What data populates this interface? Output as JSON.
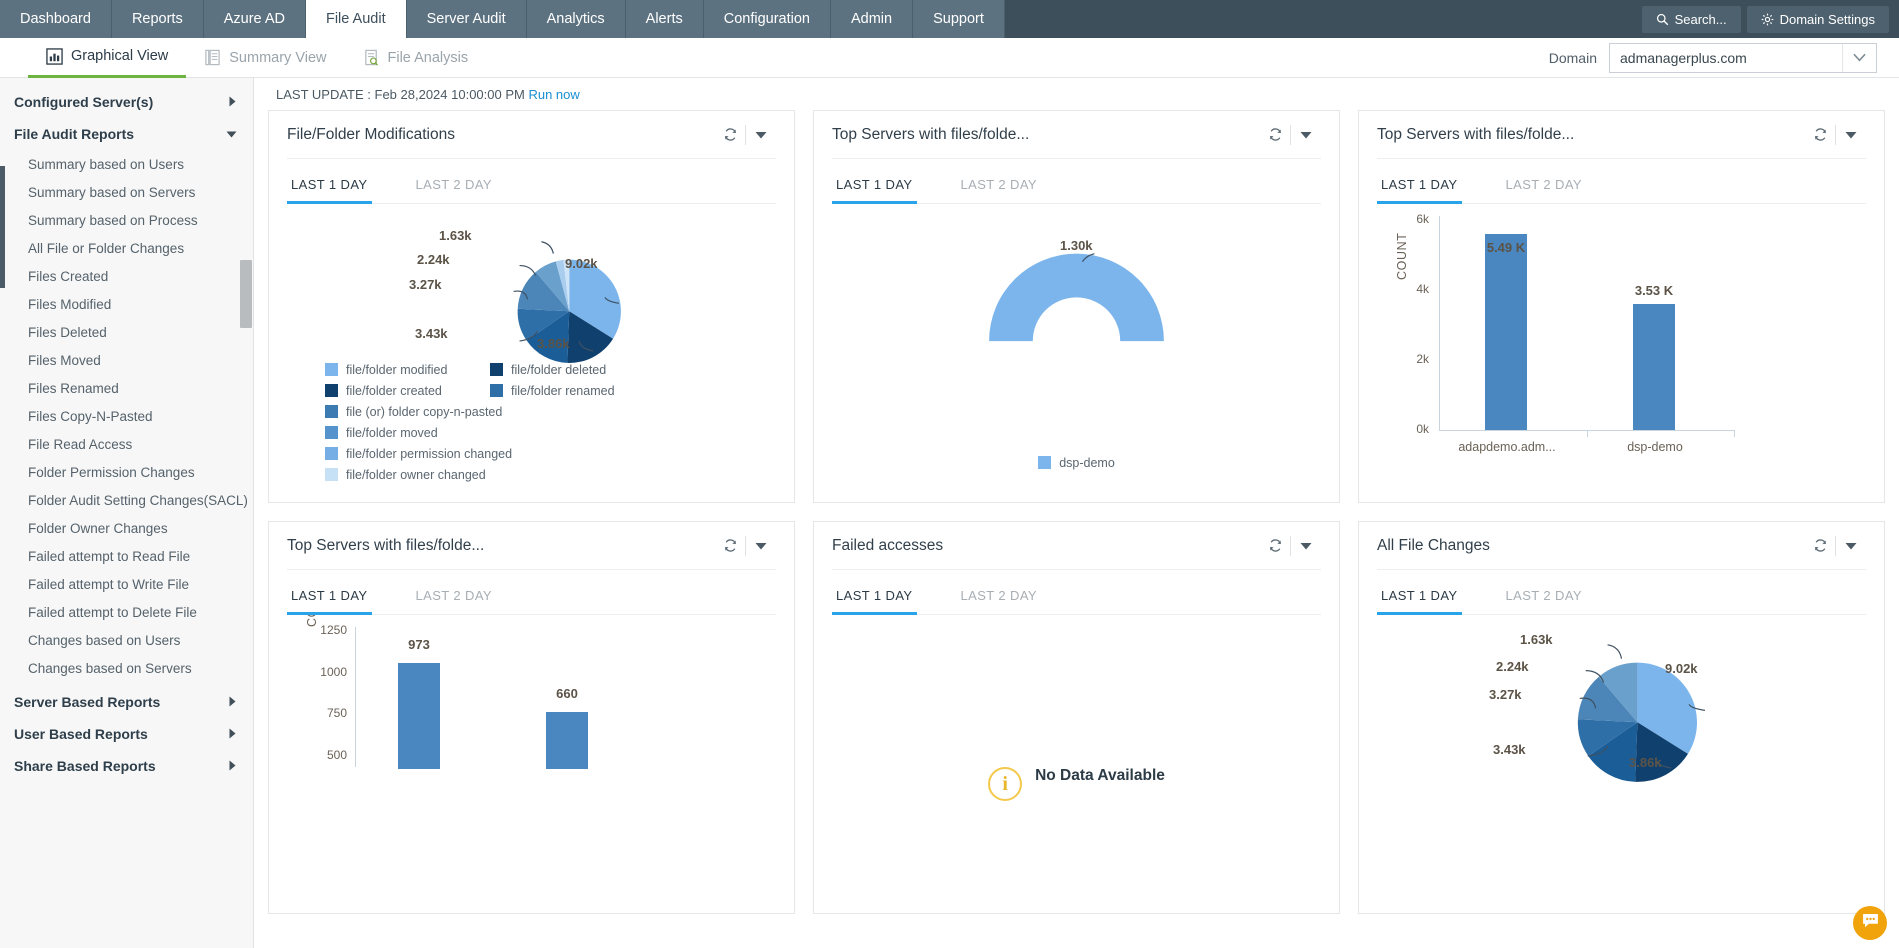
{
  "topnav": {
    "tabs": [
      {
        "label": "Dashboard",
        "active": false
      },
      {
        "label": "Reports",
        "active": false
      },
      {
        "label": "Azure AD",
        "active": false
      },
      {
        "label": "File Audit",
        "active": true
      },
      {
        "label": "Server Audit",
        "active": false
      },
      {
        "label": "Analytics",
        "active": false
      },
      {
        "label": "Alerts",
        "active": false
      },
      {
        "label": "Configuration",
        "active": false
      },
      {
        "label": "Admin",
        "active": false
      },
      {
        "label": "Support",
        "active": false
      }
    ],
    "search_label": "Search...",
    "domain_settings_label": "Domain Settings"
  },
  "subnav": {
    "tabs": [
      {
        "label": "Graphical View",
        "active": true
      },
      {
        "label": "Summary View",
        "active": false
      },
      {
        "label": "File Analysis",
        "active": false
      }
    ],
    "domain_label": "Domain",
    "domain_value": "admanagerplus.com"
  },
  "sidebar": {
    "groups": [
      {
        "label": "Configured Server(s)",
        "expanded": false
      },
      {
        "label": "File Audit Reports",
        "expanded": true
      }
    ],
    "items": [
      "Summary based on Users",
      "Summary based on Servers",
      "Summary based on Process",
      "All File or Folder Changes",
      "Files Created",
      "Files Modified",
      "Files Deleted",
      "Files Moved",
      "Files Renamed",
      "Files Copy-N-Pasted",
      "File Read Access",
      "Folder Permission Changes",
      "Folder Audit Setting Changes(SACL)",
      "Folder Owner Changes",
      "Failed attempt to Read File",
      "Failed attempt to Write File",
      "Failed attempt to Delete File",
      "Changes based on Users",
      "Changes based on Servers"
    ],
    "bottom_groups": [
      "Server Based Reports",
      "User Based Reports",
      "Share Based Reports"
    ]
  },
  "main": {
    "last_update_prefix": "LAST UPDATE : ",
    "last_update_time": "Feb 28,2024 10:00:00 PM",
    "run_now_label": "Run now",
    "tab_labels": {
      "t1": "LAST 1 DAY",
      "t2": "LAST 2 DAY"
    },
    "no_data_label": "No Data Available"
  },
  "cards": [
    {
      "title": "File/Folder Modifications"
    },
    {
      "title": "Top Servers with files/folde..."
    },
    {
      "title": "Top Servers with files/folde..."
    },
    {
      "title": "Top Servers with files/folde..."
    },
    {
      "title": "Failed accesses"
    },
    {
      "title": "All File Changes"
    }
  ],
  "chart_data": [
    {
      "type": "pie",
      "title": "File/Folder Modifications",
      "labels": [
        "file/folder modified",
        "file/folder deleted",
        "file/folder created",
        "file/folder renamed",
        "file (or) folder copy-n-pasted",
        "file/folder moved",
        "file/folder permission changed",
        "file/folder owner changed"
      ],
      "values": [
        9020,
        3860,
        3430,
        3270,
        2240,
        1630,
        0,
        0
      ],
      "value_labels": [
        "9.02k",
        "3.86k",
        "3.43k",
        "3.27k",
        "2.24k",
        "1.63k"
      ],
      "colors": [
        "#7cb5ec",
        "#10406d",
        "#1a5d97",
        "#2f6fa8",
        "#4c86b8",
        "#6aa0cc",
        "#8fbce4",
        "#c9e0f5"
      ],
      "legend_position": "bottom"
    },
    {
      "type": "pie",
      "title": "Top Servers with files/folde...",
      "variant": "half-donut",
      "labels": [
        "dsp-demo"
      ],
      "values": [
        1300
      ],
      "value_labels": [
        "1.30k"
      ],
      "colors": [
        "#7cb5ec"
      ],
      "legend_position": "bottom"
    },
    {
      "type": "bar",
      "title": "Top Servers with files/folde...",
      "categories": [
        "adapdemo.adm...",
        "dsp-demo"
      ],
      "values": [
        5490,
        3530
      ],
      "value_labels": [
        "5.49 K",
        "3.53 K"
      ],
      "ylabel": "COUNT",
      "yticks": [
        "0k",
        "2k",
        "4k",
        "6k"
      ],
      "ylim": [
        0,
        6000
      ],
      "color": "#4a86bf",
      "grid": false
    },
    {
      "type": "bar",
      "title": "Top Servers with files/folde...",
      "categories": [
        "",
        ""
      ],
      "values": [
        973,
        660
      ],
      "value_labels": [
        "973",
        "660"
      ],
      "ylabel": "COUNT",
      "yticks": [
        "500",
        "750",
        "1000",
        "1250"
      ],
      "ylim": [
        0,
        1250
      ],
      "color": "#4a86bf",
      "grid": false
    },
    {
      "type": "pie",
      "title": "Failed accesses",
      "labels": [],
      "values": [],
      "empty": true,
      "empty_message": "No Data Available"
    },
    {
      "type": "pie",
      "title": "All File Changes",
      "labels": [
        "file/folder modified",
        "file/folder deleted",
        "file/folder created",
        "file/folder renamed",
        "file (or) folder copy-n-pasted",
        "file/folder moved"
      ],
      "values": [
        9020,
        3860,
        3430,
        3270,
        2240,
        1630
      ],
      "value_labels": [
        "9.02k",
        "3.86k",
        "3.43k",
        "3.27k",
        "2.24k",
        "1.63k"
      ],
      "colors": [
        "#7cb5ec",
        "#10406d",
        "#1a5d97",
        "#2f6fa8",
        "#4c86b8",
        "#6aa0cc"
      ],
      "legend_position": "none"
    }
  ],
  "colors": {
    "nav_bg": "#3e4f5c",
    "nav_tab_bg": "#5d7280",
    "accent_green": "#6cb33f",
    "accent_blue": "#29a4e8",
    "bar_blue": "#4a86bf",
    "pie_light": "#7cb5ec",
    "pie_dark": "#10406d",
    "warning": "#f0a30a"
  }
}
